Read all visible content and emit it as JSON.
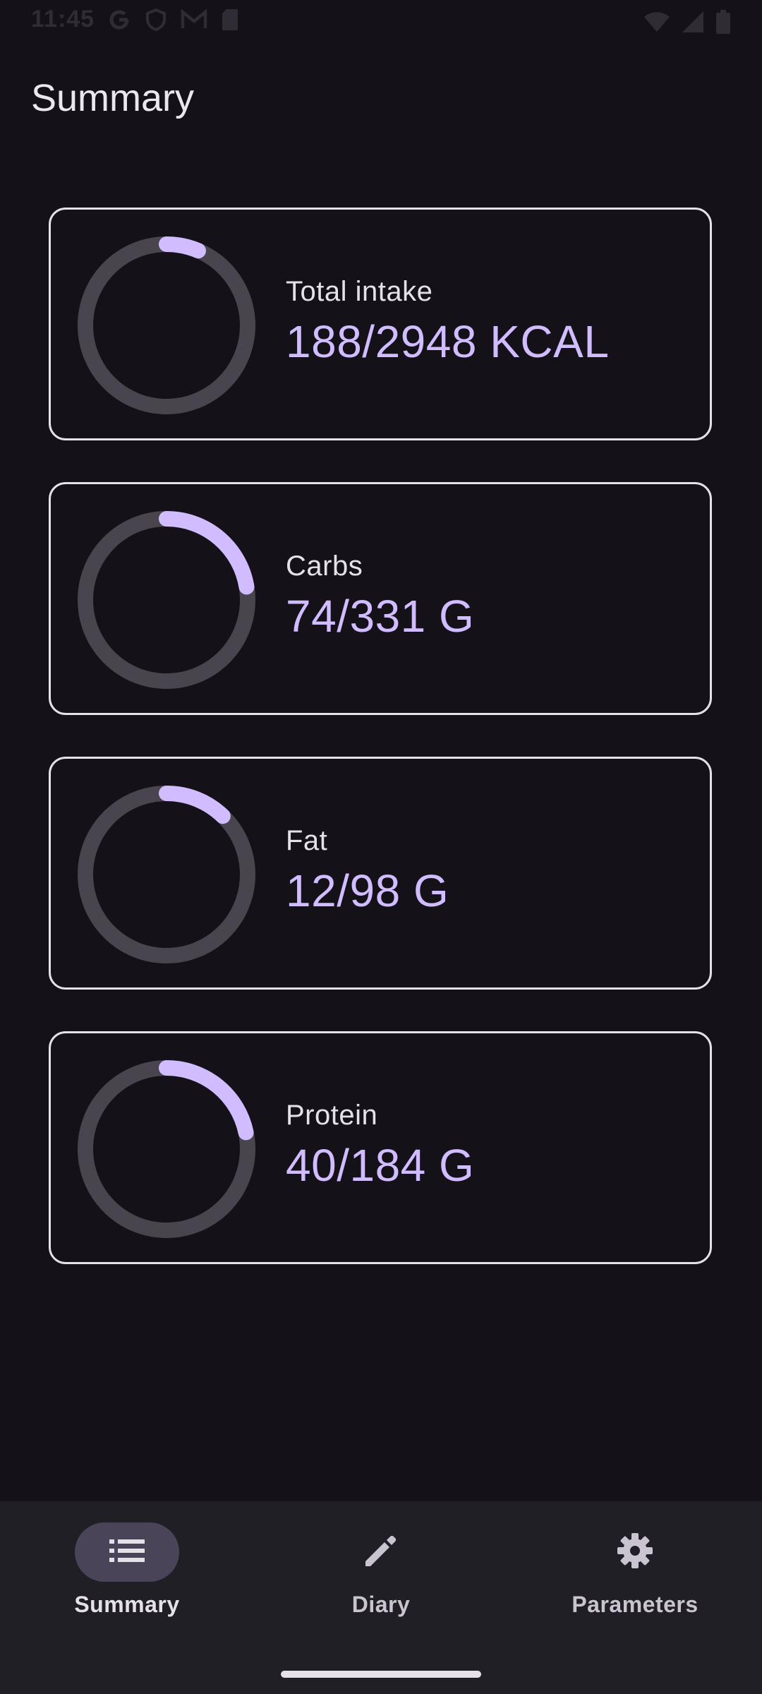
{
  "status_bar": {
    "time": "11:45",
    "left_icons": [
      "google-icon",
      "shield-icon",
      "gmail-icon",
      "sim-card-icon"
    ],
    "right_icons": [
      "wifi-icon",
      "signal-icon",
      "battery-icon"
    ]
  },
  "header": {
    "title": "Summary"
  },
  "cards": [
    {
      "label": "Total intake",
      "value": "188/2948 KCAL",
      "progress": 0.064
    },
    {
      "label": "Carbs",
      "value": "74/331 G",
      "progress": 0.224
    },
    {
      "label": "Fat",
      "value": "12/98 G",
      "progress": 0.122
    },
    {
      "label": "Protein",
      "value": "40/184 G",
      "progress": 0.217
    }
  ],
  "nav": {
    "items": [
      {
        "label": "Summary",
        "icon": "list-icon",
        "active": true
      },
      {
        "label": "Diary",
        "icon": "pencil-icon",
        "active": false
      },
      {
        "label": "Parameters",
        "icon": "gear-icon",
        "active": false
      }
    ]
  },
  "colors": {
    "background": "#141218",
    "accent": "#d0bcff",
    "track": "#49454f",
    "nav_background": "#211f26",
    "active_indicator": "#4a4458"
  }
}
